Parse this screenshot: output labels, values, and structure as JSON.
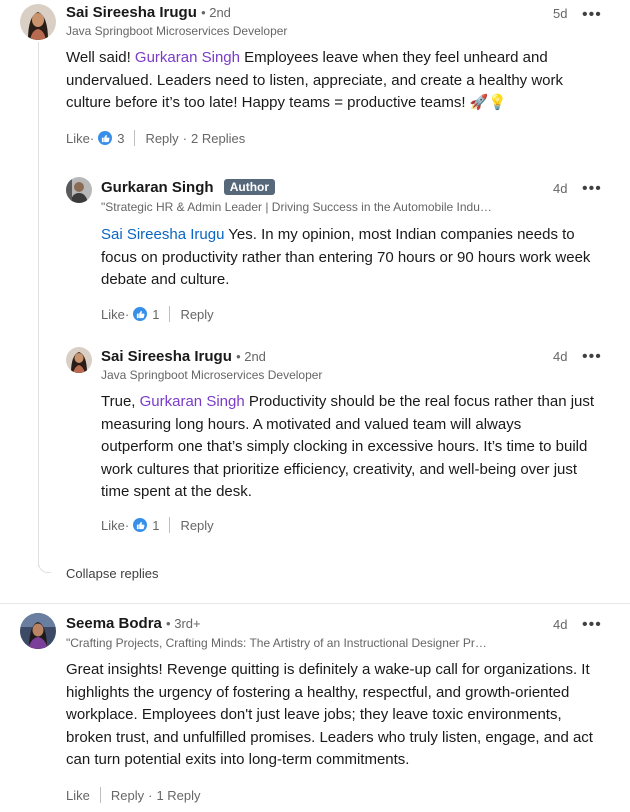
{
  "comments": [
    {
      "author": "Sai Sireesha Irugu",
      "degree": "• 2nd",
      "headline": "Java Springboot Microservices Developer",
      "time": "5d",
      "text_before": "Well said! ",
      "mention": "Gurkaran Singh",
      "text_after": " Employees leave when they feel unheard and undervalued. Leaders need to listen, appreciate, and create a healthy work culture before it’s too late! Happy teams = productive teams! 🚀💡",
      "like_label": "Like",
      "reaction_count": "3",
      "reply_label": "Reply",
      "replies_label": "2 Replies"
    },
    {
      "author": "Gurkaran Singh",
      "badge": "Author",
      "headline": "\"Strategic HR & Admin Leader | Driving Success in the Automobile Indu…",
      "time": "4d",
      "mention": "Sai Sireesha Irugu",
      "text_after": " Yes. In my opinion, most Indian companies needs to focus on productivity rather than entering 70 hours or 90 hours work week debate and culture.",
      "like_label": "Like",
      "reaction_count": "1",
      "reply_label": "Reply"
    },
    {
      "author": "Sai Sireesha Irugu",
      "degree": "• 2nd",
      "headline": "Java Springboot Microservices Developer",
      "time": "4d",
      "text_before": "True, ",
      "mention": "Gurkaran Singh",
      "text_after": " Productivity should be the real focus rather than just measuring long hours. A motivated and valued team will always outperform one that’s simply clocking in excessive hours. It’s time to build work cultures that prioritize efficiency, creativity, and well-being over just time spent at the desk.",
      "like_label": "Like",
      "reaction_count": "1",
      "reply_label": "Reply"
    },
    {
      "author": "Seema Bodra",
      "degree": "• 3rd+",
      "headline": "\"Crafting Projects, Crafting Minds: The Artistry of an Instructional Designer Pr…",
      "time": "4d",
      "text": "Great insights! Revenge quitting is definitely a wake-up call for organizations. It highlights the urgency of fostering a healthy, respectful, and growth-oriented workplace. Employees don't just leave jobs; they leave toxic environments, broken trust, and unfulfilled promises. Leaders who truly listen, engage, and act can turn potential exits into long-term commitments.",
      "like_label": "Like",
      "reply_label": "Reply",
      "replies_label": "1 Reply"
    }
  ],
  "collapse_label": "Collapse replies",
  "more_label": "•••",
  "separator": "·",
  "colors": {
    "mention_purple": "#7a3bc8",
    "mention_blue": "#0a66c2",
    "like_blue": "#378fe9",
    "author_badge": "#56687a"
  }
}
